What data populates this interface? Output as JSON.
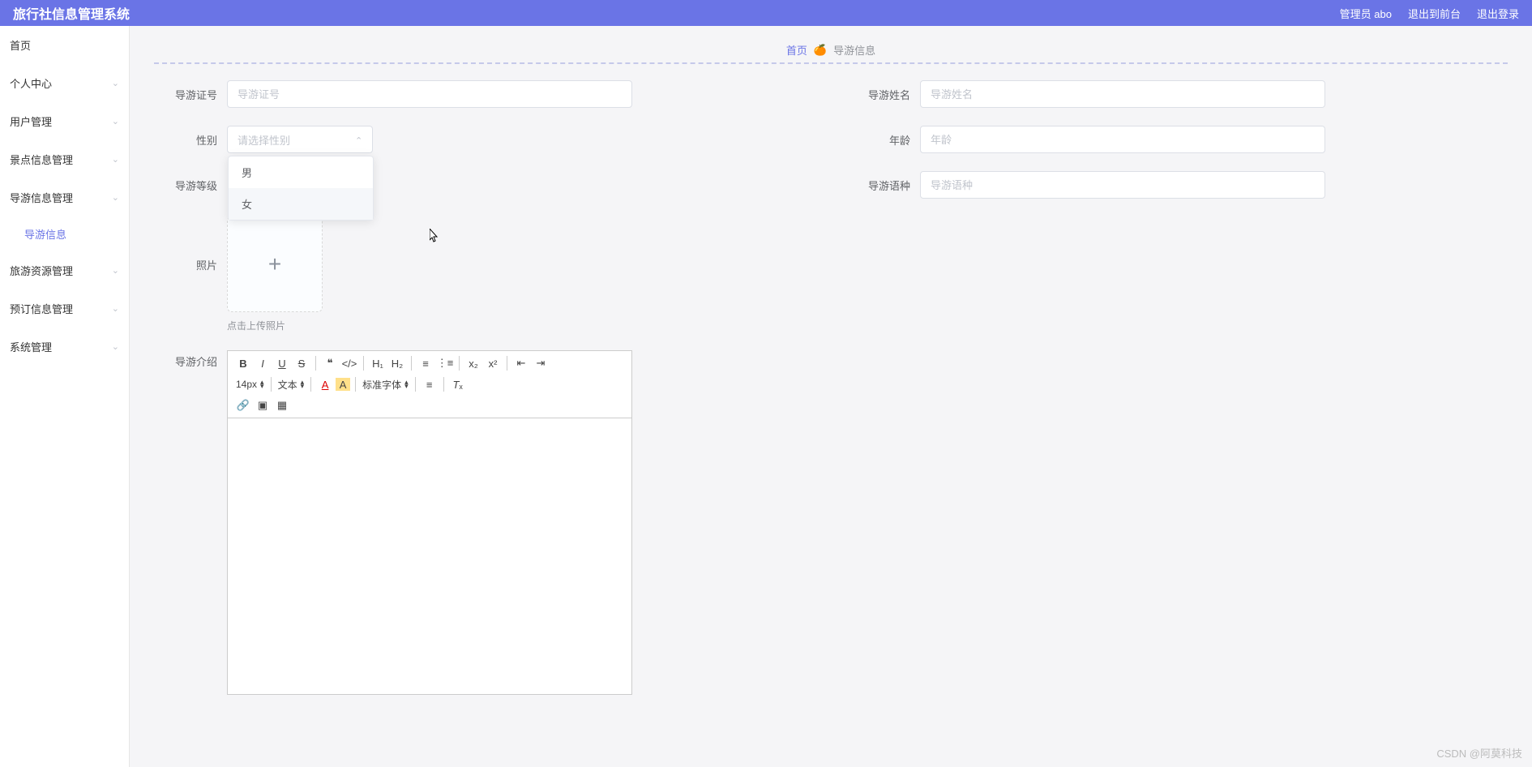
{
  "header": {
    "title": "旅行社信息管理系统",
    "user_label": "管理员 abo",
    "logout_front": "退出到前台",
    "logout": "退出登录"
  },
  "sidebar": {
    "items": [
      {
        "label": "首页",
        "expandable": false
      },
      {
        "label": "个人中心",
        "expandable": true
      },
      {
        "label": "用户管理",
        "expandable": true
      },
      {
        "label": "景点信息管理",
        "expandable": true
      },
      {
        "label": "导游信息管理",
        "expandable": true,
        "expanded": true,
        "children": [
          {
            "label": "导游信息"
          }
        ]
      },
      {
        "label": "旅游资源管理",
        "expandable": true
      },
      {
        "label": "预订信息管理",
        "expandable": true
      },
      {
        "label": "系统管理",
        "expandable": true
      }
    ]
  },
  "breadcrumb": {
    "home": "首页",
    "separator": "🍊",
    "current": "导游信息"
  },
  "form": {
    "guide_id": {
      "label": "导游证号",
      "placeholder": "导游证号"
    },
    "guide_name": {
      "label": "导游姓名",
      "placeholder": "导游姓名"
    },
    "gender": {
      "label": "性别",
      "placeholder": "请选择性别",
      "options": [
        "男",
        "女"
      ]
    },
    "age": {
      "label": "年龄",
      "placeholder": "年龄"
    },
    "guide_level": {
      "label": "导游等级"
    },
    "guide_lang": {
      "label": "导游语种",
      "placeholder": "导游语种"
    },
    "photo": {
      "label": "照片",
      "hint": "点击上传照片"
    },
    "intro": {
      "label": "导游介绍"
    }
  },
  "editor": {
    "font_size": "14px",
    "text_type": "文本",
    "font_family": "标准字体"
  },
  "watermark": "CSDN @阿莫科技"
}
